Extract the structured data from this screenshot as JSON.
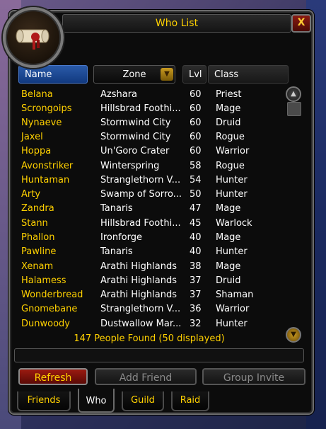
{
  "window": {
    "title": "Who List",
    "close_label": "X"
  },
  "columns": {
    "name": "Name",
    "zone": "Zone",
    "lvl": "Lvl",
    "class": "Class"
  },
  "rows": [
    {
      "name": "Belana",
      "zone": "Azshara",
      "lvl": "60",
      "class": "Priest"
    },
    {
      "name": "Scrongoips",
      "zone": "Hillsbrad Foothi...",
      "lvl": "60",
      "class": "Mage"
    },
    {
      "name": "Nynaeve",
      "zone": "Stormwind City",
      "lvl": "60",
      "class": "Druid"
    },
    {
      "name": "Jaxel",
      "zone": "Stormwind City",
      "lvl": "60",
      "class": "Rogue"
    },
    {
      "name": "Hoppa",
      "zone": "Un'Goro Crater",
      "lvl": "60",
      "class": "Warrior"
    },
    {
      "name": "Avonstriker",
      "zone": "Winterspring",
      "lvl": "58",
      "class": "Rogue"
    },
    {
      "name": "Huntaman",
      "zone": "Stranglethorn V...",
      "lvl": "54",
      "class": "Hunter"
    },
    {
      "name": "Arty",
      "zone": "Swamp of Sorro...",
      "lvl": "50",
      "class": "Hunter"
    },
    {
      "name": "Zandra",
      "zone": "Tanaris",
      "lvl": "47",
      "class": "Mage"
    },
    {
      "name": "Stann",
      "zone": "Hillsbrad Foothi...",
      "lvl": "45",
      "class": "Warlock"
    },
    {
      "name": "Phallon",
      "zone": "Ironforge",
      "lvl": "40",
      "class": "Mage"
    },
    {
      "name": "Pawline",
      "zone": "Tanaris",
      "lvl": "40",
      "class": "Hunter"
    },
    {
      "name": "Xenam",
      "zone": "Arathi Highlands",
      "lvl": "38",
      "class": "Mage"
    },
    {
      "name": "Halamess",
      "zone": "Arathi Highlands",
      "lvl": "37",
      "class": "Druid"
    },
    {
      "name": "Wonderbread",
      "zone": "Arathi Highlands",
      "lvl": "37",
      "class": "Shaman"
    },
    {
      "name": "Gnomebane",
      "zone": "Stranglethorn V...",
      "lvl": "36",
      "class": "Warrior"
    },
    {
      "name": "Dunwoody",
      "zone": "Dustwallow Mar...",
      "lvl": "32",
      "class": "Hunter"
    }
  ],
  "status": {
    "found": "147 People Found  (50 displayed)"
  },
  "buttons": {
    "refresh": "Refresh",
    "add_friend": "Add Friend",
    "group_invite": "Group Invite"
  },
  "tabs": {
    "friends": "Friends",
    "who": "Who",
    "guild": "Guild",
    "raid": "Raid",
    "active": "Who"
  },
  "icons": {
    "portrait": "scroll-icon",
    "zone_dropdown": "chevron-down-icon",
    "scroll_up": "arrow-up-icon",
    "scroll_down": "arrow-down-icon"
  },
  "colors": {
    "name_text": "#ffd100",
    "title_text": "#ffd100",
    "refresh_bg": "#9a1a10",
    "name_header_bg": "#2a5aa8"
  }
}
